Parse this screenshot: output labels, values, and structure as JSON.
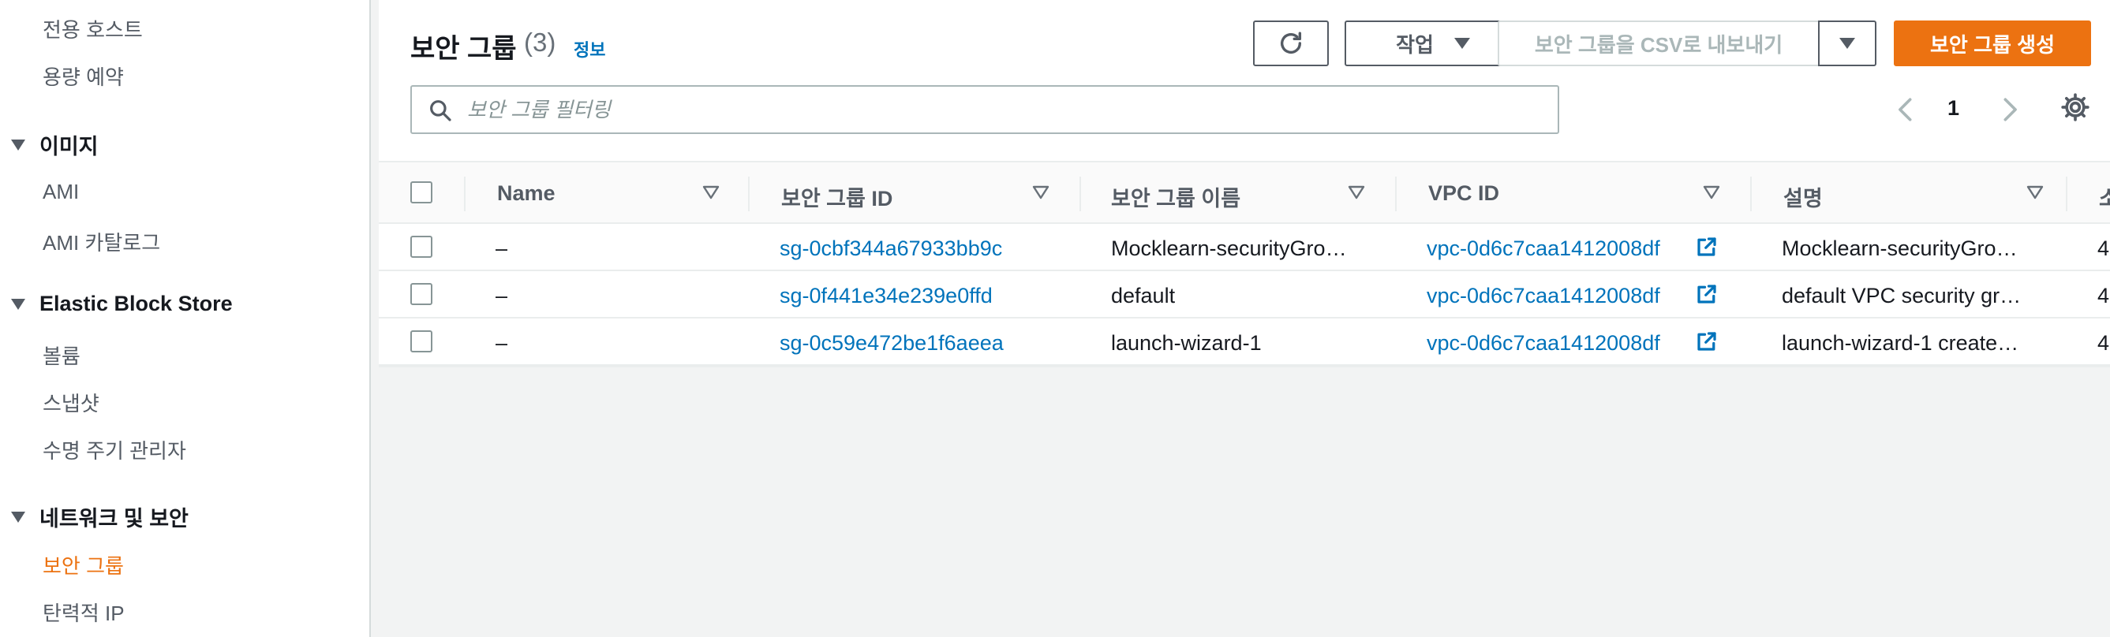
{
  "sidebar": {
    "items": [
      {
        "label": "전용 호스트",
        "type": "item"
      },
      {
        "label": "용량 예약",
        "type": "item"
      },
      {
        "label": "이미지",
        "type": "section"
      },
      {
        "label": "AMI",
        "type": "item"
      },
      {
        "label": "AMI 카탈로그",
        "type": "item"
      },
      {
        "label": "Elastic Block Store",
        "type": "section"
      },
      {
        "label": "볼륨",
        "type": "item"
      },
      {
        "label": "스냅샷",
        "type": "item"
      },
      {
        "label": "수명 주기 관리자",
        "type": "item"
      },
      {
        "label": "네트워크 및 보안",
        "type": "section"
      },
      {
        "label": "보안 그룹",
        "type": "item",
        "active": true
      },
      {
        "label": "탄력적 IP",
        "type": "item"
      }
    ]
  },
  "header": {
    "title": "보안 그룹",
    "count": "(3)",
    "info": "정보"
  },
  "toolbar": {
    "refresh_icon": "refresh-icon",
    "actions_label": "작업",
    "export_label": "보안 그룹을 CSV로 내보내기",
    "create_label": "보안 그룹 생성"
  },
  "search": {
    "placeholder": "보안 그룹 필터링",
    "value": ""
  },
  "pagination": {
    "current": "1"
  },
  "table": {
    "columns": [
      "Name",
      "보안 그룹 ID",
      "보안 그룹 이름",
      "VPC ID",
      "설명",
      "소"
    ],
    "rows": [
      {
        "name": "–",
        "group_id": "sg-0cbf344a67933bb9c",
        "group_name": "Mocklearn-securityGro…",
        "vpc_id": "vpc-0d6c7caa1412008df",
        "description": "Mocklearn-securityGro…",
        "owner": "4"
      },
      {
        "name": "–",
        "group_id": "sg-0f441e34e239e0ffd",
        "group_name": "default",
        "vpc_id": "vpc-0d6c7caa1412008df",
        "description": "default VPC security gr…",
        "owner": "4"
      },
      {
        "name": "–",
        "group_id": "sg-0c59e472be1f6aeea",
        "group_name": "launch-wizard-1",
        "vpc_id": "vpc-0d6c7caa1412008df",
        "description": "launch-wizard-1 create…",
        "owner": "4"
      }
    ]
  },
  "colors": {
    "accent": "#ec7211",
    "link": "#0073bb",
    "text": "#16191f",
    "muted": "#545b64",
    "background": "#f2f3f3"
  }
}
